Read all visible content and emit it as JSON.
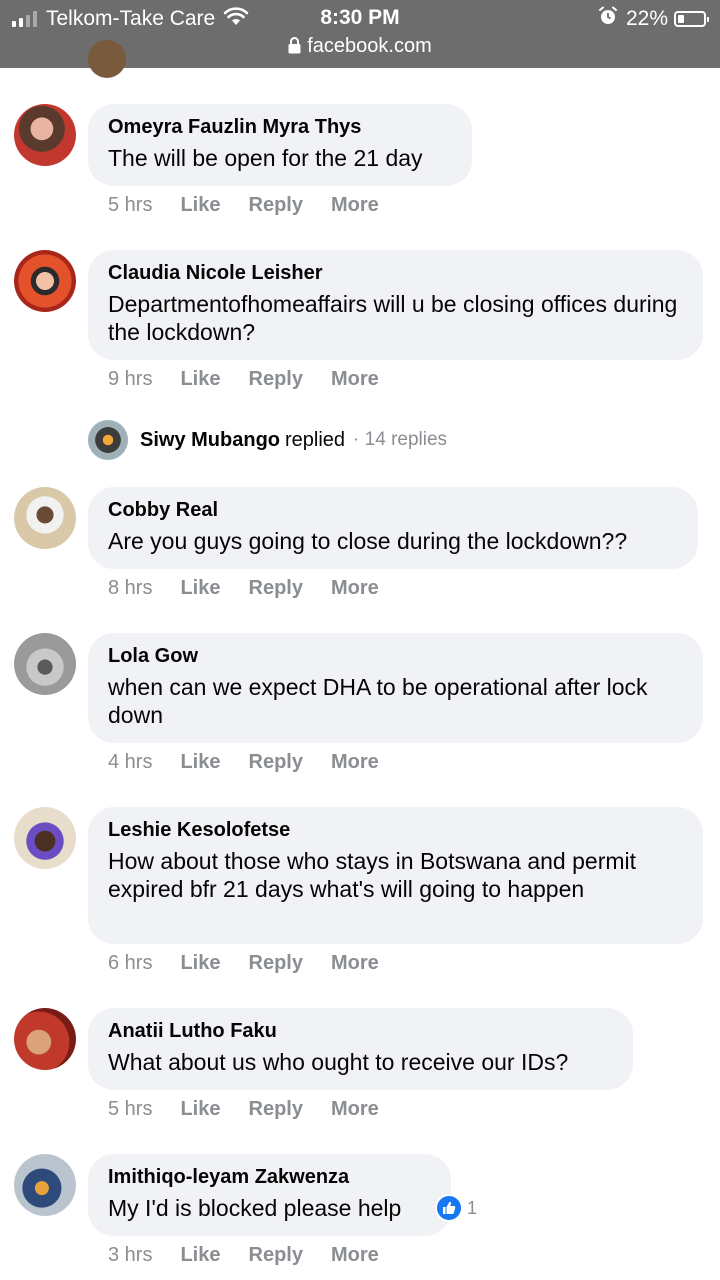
{
  "status_bar": {
    "carrier": "Telkom-Take Care",
    "time": "8:30 PM",
    "url": "facebook.com",
    "battery": "22%",
    "battery_level": 0.22,
    "signal_bars": 2
  },
  "colors": {
    "status_bar_bg": "#6d6d6d",
    "bubble_bg": "#f0f2f5",
    "meta_text": "#8a8d91",
    "like_blue": "#1877f2"
  },
  "comments": [
    {
      "author": "Omeyra Fauzlin Myra Thys",
      "text": "The will be open for the 21 day",
      "time": "5 hrs",
      "like": "Like",
      "reply": "Reply",
      "more": "More"
    },
    {
      "author": "Claudia Nicole Leisher",
      "text": "Departmentofhomeaffairs will u be closing offices during the lockdown?",
      "time": "9 hrs",
      "like": "Like",
      "reply": "Reply",
      "more": "More",
      "replies": {
        "name": "Siwy Mubango",
        "verb": "replied",
        "count": "· 14 replies"
      }
    },
    {
      "author": "Cobby Real",
      "text": "Are you guys going to close during the lockdown??",
      "time": "8 hrs",
      "like": "Like",
      "reply": "Reply",
      "more": "More"
    },
    {
      "author": "Lola Gow",
      "text": "when can we expect DHA to be operational after lock down",
      "time": "4 hrs",
      "like": "Like",
      "reply": "Reply",
      "more": "More"
    },
    {
      "author": "Leshie Kesolofetse",
      "text": "How about those who stays in Botswana and permit expired bfr 21 days what's will going to happen",
      "time": "6 hrs",
      "like": "Like",
      "reply": "Reply",
      "more": "More"
    },
    {
      "author": "Anatii Lutho Faku",
      "text": "What about us who ought to receive our IDs?",
      "time": "5 hrs",
      "like": "Like",
      "reply": "Reply",
      "more": "More"
    },
    {
      "author": "Imithiqo-leyam Zakwenza",
      "text": "My I'd is blocked please help",
      "time": "3 hrs",
      "like": "Like",
      "reply": "Reply",
      "more": "More",
      "reaction_count": "1",
      "reaction_icon": "thumbs-up-icon"
    }
  ]
}
